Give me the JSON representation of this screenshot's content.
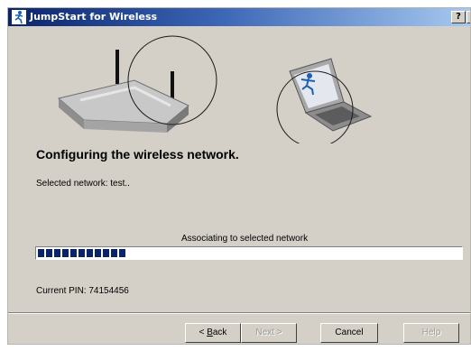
{
  "window": {
    "title": "JumpStart for Wireless",
    "help_glyph": "?",
    "close_glyph": "×"
  },
  "main": {
    "heading": "Configuring the wireless network.",
    "selected_network": "Selected network: test..",
    "status": "Associating to selected network",
    "progress_percent": 21,
    "current_pin": "Current PIN: 74154456"
  },
  "buttons": {
    "back_prefix": "< ",
    "back_mnemonic": "B",
    "back_rest": "ack",
    "next_label": "Next >",
    "cancel_label": "Cancel",
    "help_label": "Help"
  },
  "colors": {
    "title_start": "#0a246a",
    "title_end": "#a6caf0",
    "dialog_bg": "#d4d0c8",
    "progress_fill": "#0a246a"
  },
  "icons": {
    "app": "jumpstart-runner-icon",
    "router": "router-illustration",
    "laptop": "laptop-illustration"
  }
}
